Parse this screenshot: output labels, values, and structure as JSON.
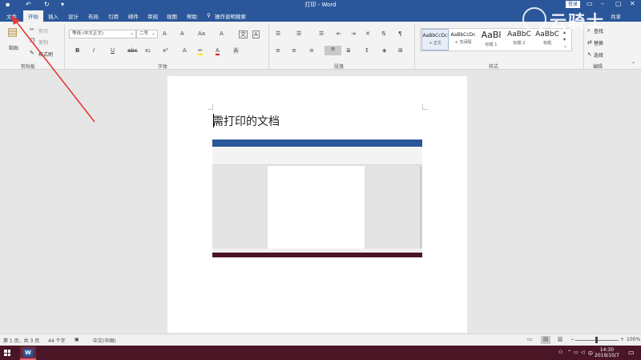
{
  "titlebar": {
    "title": "打印 - Word",
    "login": "登录"
  },
  "tabs": [
    {
      "label": "文件",
      "active": false
    },
    {
      "label": "开始",
      "active": true
    },
    {
      "label": "插入",
      "active": false
    },
    {
      "label": "设计",
      "active": false
    },
    {
      "label": "布局",
      "active": false
    },
    {
      "label": "引用",
      "active": false
    },
    {
      "label": "邮件",
      "active": false
    },
    {
      "label": "审阅",
      "active": false
    },
    {
      "label": "视图",
      "active": false
    },
    {
      "label": "帮助",
      "active": false
    }
  ],
  "tell_me": "操作说明搜索",
  "share": "共享",
  "clipboard": {
    "paste": "粘贴",
    "cut": "剪切",
    "copy": "复制",
    "format_painter": "格式刷",
    "group": "剪贴板"
  },
  "font": {
    "name": "等线 (中文正文)",
    "size": "二号",
    "group": "字体"
  },
  "paragraph": {
    "group": "段落"
  },
  "styles": {
    "group": "样式",
    "items": [
      {
        "preview": "AaBbCcDc",
        "name": "+ 正文"
      },
      {
        "preview": "AaBbCcDc",
        "name": "+ 无间隔"
      },
      {
        "preview": "AaBl",
        "name": "标题 1"
      },
      {
        "preview": "AaBbC",
        "name": "标题 2"
      },
      {
        "preview": "AaBbC",
        "name": "标题"
      }
    ]
  },
  "editing": {
    "find": "查找",
    "replace": "替换",
    "select": "选择",
    "group": "编辑"
  },
  "document": {
    "text": "需打印的文档"
  },
  "status": {
    "page": "第 1 页，共 3 页",
    "words": "44 个字",
    "language": "中文(中国)",
    "zoom": "100%"
  },
  "taskbar": {
    "time": "14:30",
    "date": "2019/10/7",
    "ime": "中"
  },
  "watermark": {
    "brand": "云骑士"
  },
  "colors": {
    "accent": "#2b579a",
    "taskbar": "#4a1626",
    "arrow": "#e53935"
  }
}
